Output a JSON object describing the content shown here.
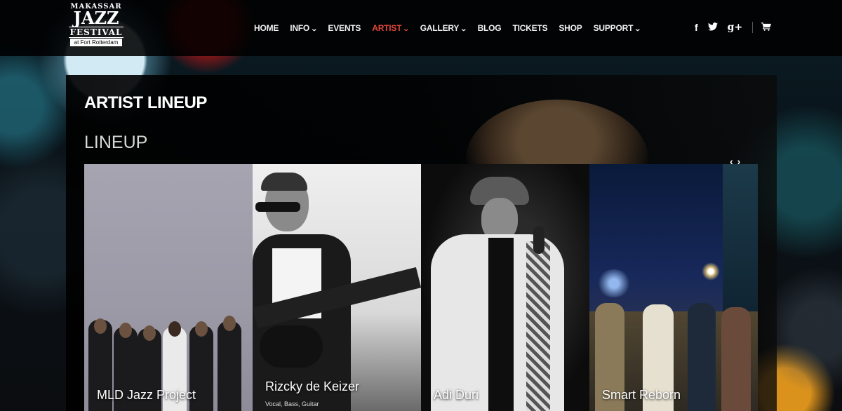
{
  "logo": {
    "line1": "MAKASSAR",
    "line2": "JAZZ",
    "line3": "FESTIVAL",
    "line4": "at Fort Rotterdam"
  },
  "nav": {
    "items": [
      {
        "label": "HOME",
        "dropdown": false,
        "active": false
      },
      {
        "label": "INFO",
        "dropdown": true,
        "active": false
      },
      {
        "label": "EVENTS",
        "dropdown": false,
        "active": false
      },
      {
        "label": "ARTIST",
        "dropdown": true,
        "active": true
      },
      {
        "label": "GALLERY",
        "dropdown": true,
        "active": false
      },
      {
        "label": "BLOG",
        "dropdown": false,
        "active": false
      },
      {
        "label": "TICKETS",
        "dropdown": false,
        "active": false
      },
      {
        "label": "SHOP",
        "dropdown": false,
        "active": false
      },
      {
        "label": "SUPPORT",
        "dropdown": true,
        "active": false
      }
    ],
    "active_color": "#e0463a"
  },
  "social": {
    "facebook": "f",
    "twitter": "🐦",
    "googleplus": "g+",
    "cart": "🛒"
  },
  "panel": {
    "title": "ARTIST LINEUP",
    "section": "LINEUP",
    "prev_arrow": "‹",
    "next_arrow": "›"
  },
  "artists": [
    {
      "name": "MLD Jazz Project",
      "subtitle": ""
    },
    {
      "name": "Rizcky de Keizer",
      "subtitle": "Vocal, Bass, Guitar"
    },
    {
      "name": "Adi Duri",
      "subtitle": ""
    },
    {
      "name": "Smart Reborn",
      "subtitle": ""
    }
  ]
}
